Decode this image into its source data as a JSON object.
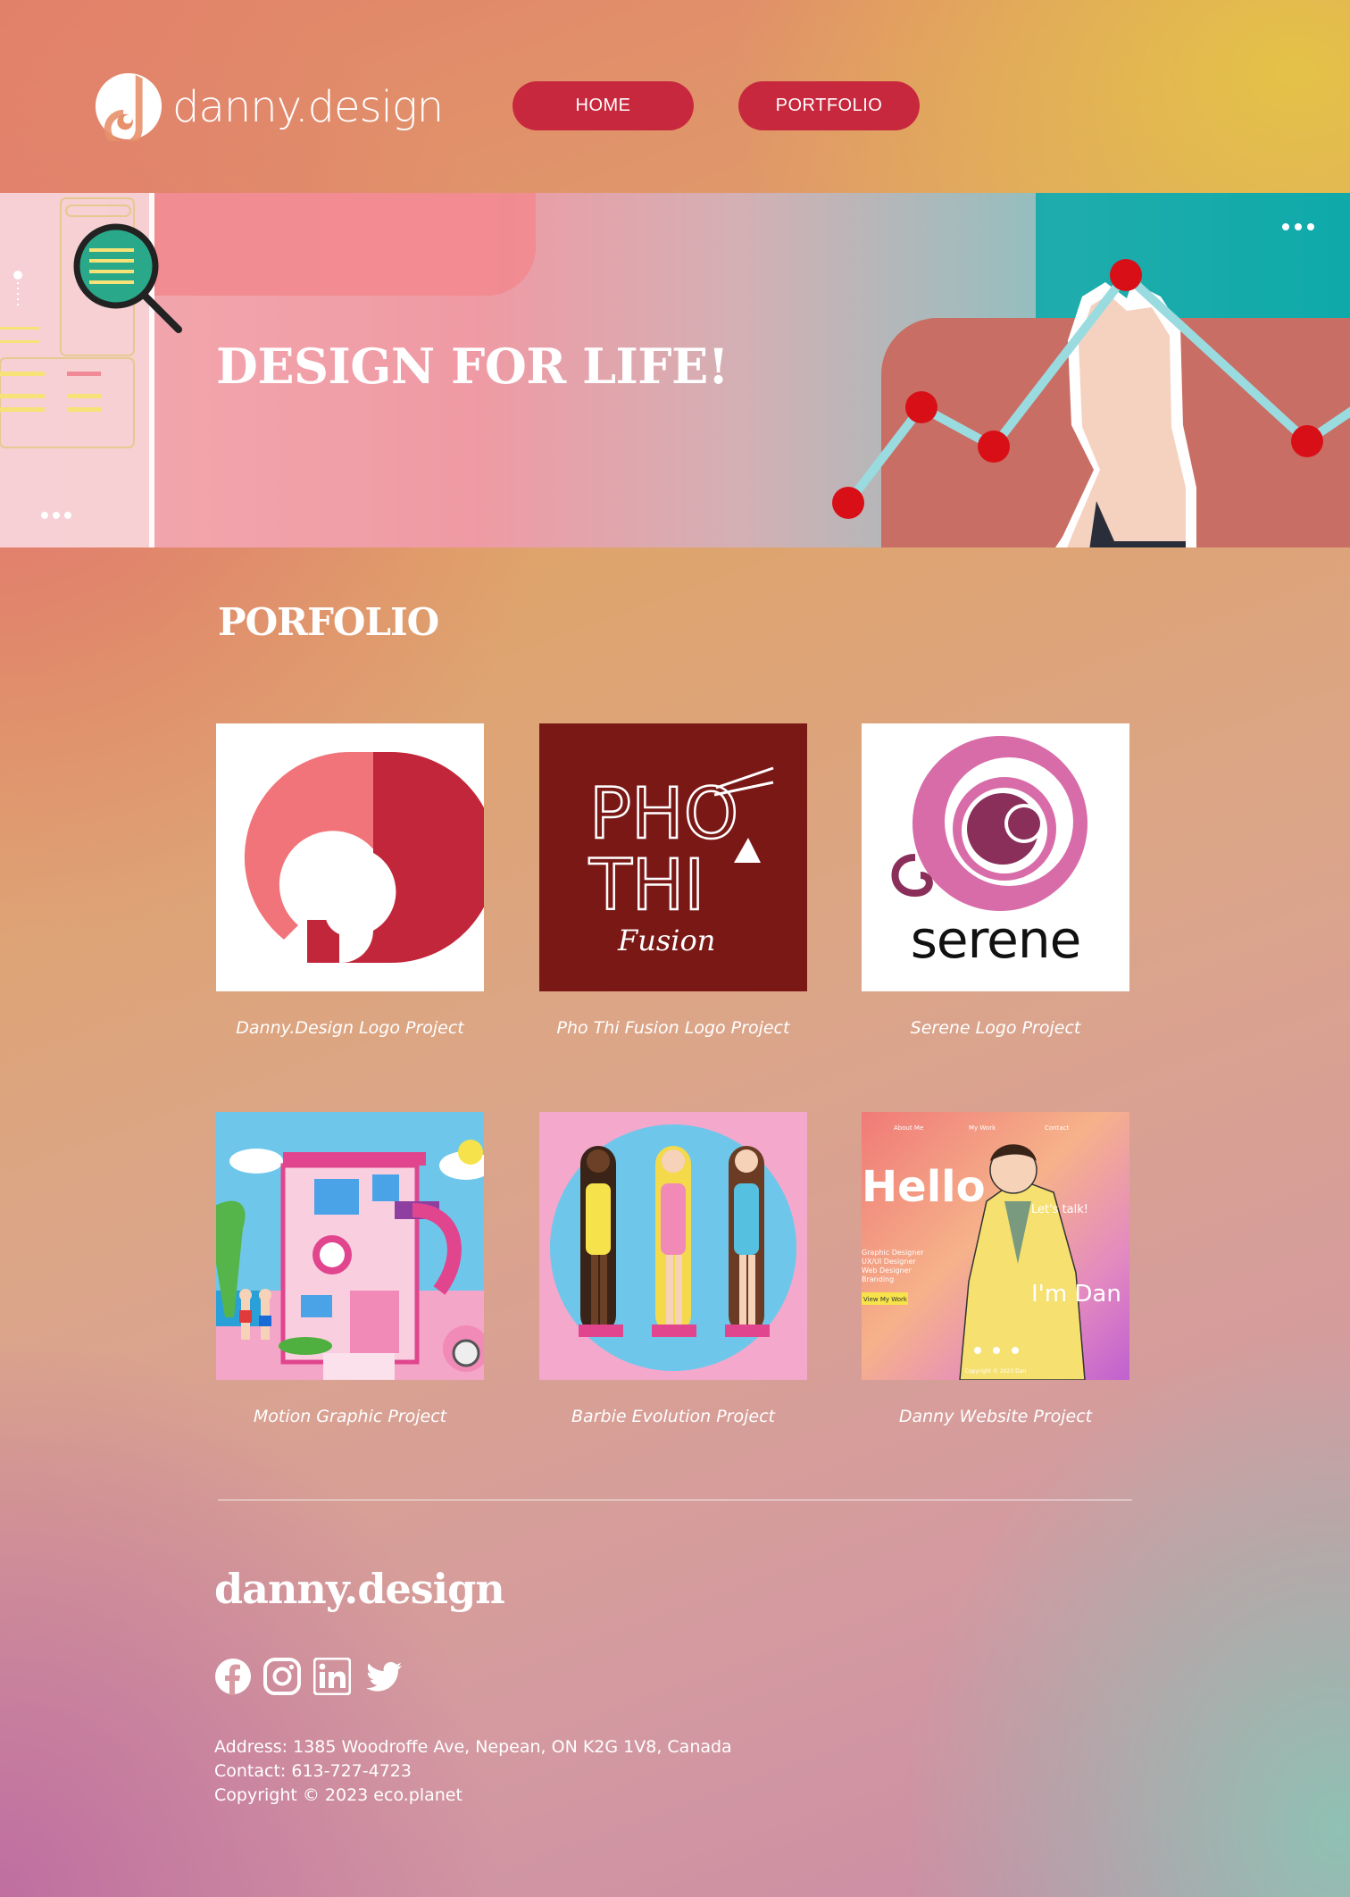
{
  "header": {
    "logo_text": "danny.design",
    "nav": [
      {
        "label": "HOME"
      },
      {
        "label": "PORTFOLIO"
      }
    ]
  },
  "hero": {
    "title": "DESIGN FOR LIFE!"
  },
  "portfolio": {
    "title": "PORFOLIO",
    "items": [
      {
        "caption": "Danny.Design Logo Project",
        "icon": "danny-design-logo"
      },
      {
        "caption": "Pho Thi Fusion Logo Project",
        "icon": "pho-thi-fusion-logo"
      },
      {
        "caption": "Serene Logo Project",
        "icon": "serene-logo"
      },
      {
        "caption": "Motion Graphic Project",
        "icon": "barbie-house-illustration"
      },
      {
        "caption": "Barbie Evolution Project",
        "icon": "barbie-dolls-illustration"
      },
      {
        "caption": "Danny Website Project",
        "icon": "website-preview"
      }
    ],
    "card_text": {
      "pho_line1": "PHO",
      "pho_line2": "THI",
      "pho_fusion": "Fusion",
      "serene": "serene",
      "web_nav1": "About Me",
      "web_nav2": "My Work",
      "web_nav3": "Contact",
      "web_hello": "Hello",
      "web_letstalk": "Let's talk!",
      "web_roles1": "Graphic Designer",
      "web_roles2": "UX/UI Designer",
      "web_roles3": "Web Designer",
      "web_roles4": "Branding",
      "web_view": "View My Work",
      "web_imdan": "I'm Dan",
      "web_copy": "Copyright © 2023 Dan"
    }
  },
  "footer": {
    "brand": "danny.design",
    "social": [
      "facebook-icon",
      "instagram-icon",
      "linkedin-icon",
      "twitter-icon"
    ],
    "address": "Address: 1385 Woodroffe Ave, Nepean, ON K2G 1V8, Canada",
    "contact": "Contact: 613-727-4723",
    "copyright": "Copyright © 2023 eco.planet"
  },
  "colors": {
    "accent": "#c8283e",
    "pho_bg": "#7a1816",
    "serene_pink": "#d86ca8",
    "serene_plum": "#8a2f5a"
  }
}
